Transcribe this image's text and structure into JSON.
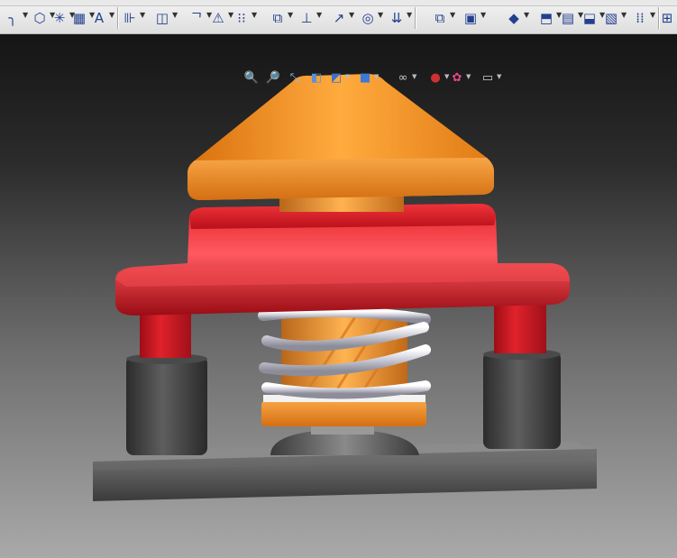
{
  "app": {
    "kind": "CAD 3D part viewer"
  },
  "toolbar": {
    "buttons": [
      {
        "name": "line-icon",
        "glyph": "╮"
      },
      {
        "name": "polygon-icon",
        "glyph": "⬡"
      },
      {
        "name": "point-icon",
        "glyph": "✳"
      },
      {
        "name": "grid-snap-icon",
        "glyph": "▦"
      },
      {
        "name": "text-icon",
        "glyph": "A"
      },
      {
        "name": "mirror-entities-icon",
        "glyph": "⊪"
      },
      {
        "name": "offset-entities-icon",
        "glyph": "◫"
      },
      {
        "name": "trim-icon",
        "glyph": "ᄀ"
      },
      {
        "name": "warning-icon",
        "glyph": "⚠"
      },
      {
        "name": "linear-pattern-icon",
        "glyph": "⁝⁝"
      },
      {
        "name": "move-entities-icon",
        "glyph": "⧉"
      },
      {
        "name": "relations-icon",
        "glyph": "⊥"
      },
      {
        "name": "smart-dimension-icon",
        "glyph": "↗"
      },
      {
        "name": "repair-sketch-icon",
        "glyph": "◎"
      },
      {
        "name": "quick-snaps-icon",
        "glyph": "⇊"
      },
      {
        "name": "copy-icon",
        "glyph": "⧉"
      },
      {
        "name": "component-icon",
        "glyph": "▣"
      },
      {
        "name": "appearance-icon",
        "glyph": "◆"
      },
      {
        "name": "insert-part-icon",
        "glyph": "⬒"
      },
      {
        "name": "assembly-icon",
        "glyph": "▤"
      },
      {
        "name": "explode-icon",
        "glyph": "⬓"
      },
      {
        "name": "bill-of-materials-icon",
        "glyph": "▧"
      },
      {
        "name": "pattern-grid-icon",
        "glyph": "⁞⁞"
      },
      {
        "name": "display-options-icon",
        "glyph": "⊞"
      }
    ]
  },
  "view_toolbar": {
    "buttons": [
      {
        "name": "zoom-to-fit-icon",
        "glyph": "🔍"
      },
      {
        "name": "zoom-to-area-icon",
        "glyph": "🔎"
      },
      {
        "name": "previous-view-icon",
        "glyph": "⤡"
      },
      {
        "name": "section-view-icon",
        "glyph": "◧"
      },
      {
        "name": "view-orientation-icon",
        "glyph": "◩"
      },
      {
        "name": "display-style-icon",
        "glyph": "■"
      },
      {
        "name": "hide-show-items-icon",
        "glyph": "∞"
      },
      {
        "name": "edit-appearance-icon",
        "glyph": "●"
      },
      {
        "name": "apply-scene-icon",
        "glyph": "✿"
      },
      {
        "name": "view-settings-icon",
        "glyph": "▭"
      }
    ]
  },
  "colors": {
    "cap": "#f08f1c",
    "frame": "#d41a1c",
    "post": "#404040",
    "base": "#5c5c5c",
    "spring": "#e4e4ec",
    "core": "#e98a25"
  }
}
